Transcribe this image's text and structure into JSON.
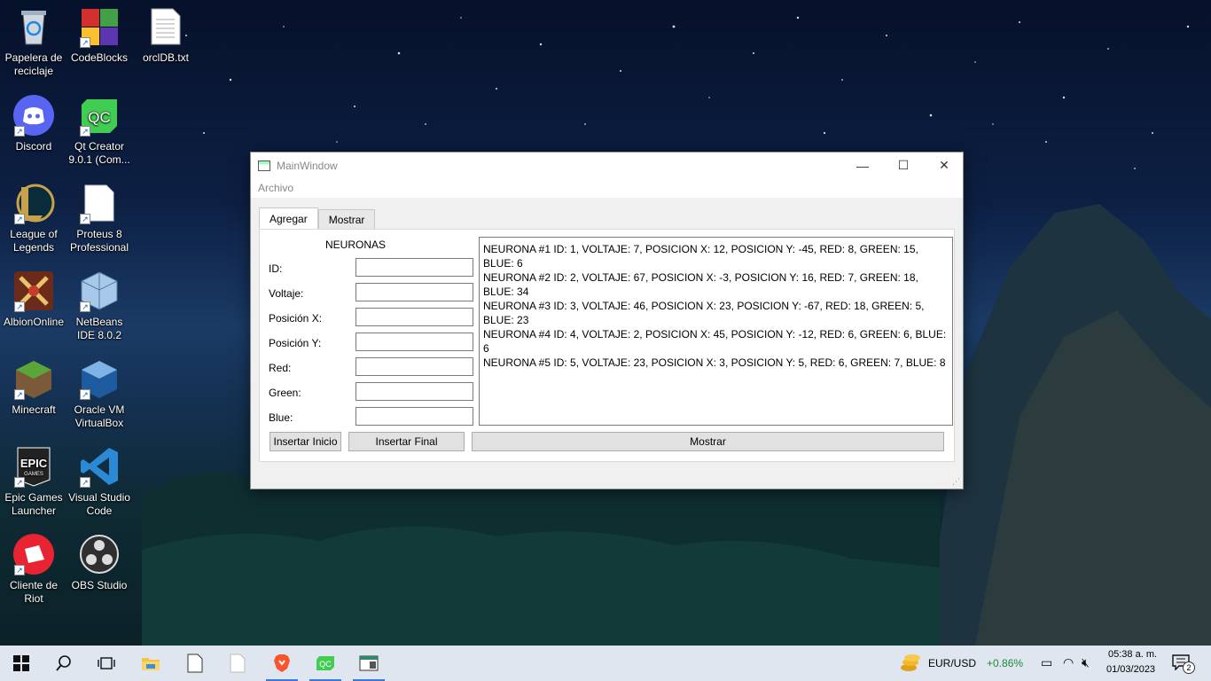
{
  "desktop": {
    "icons": [
      {
        "label": "Papelera de reciclaje",
        "icon": "recycle-bin-icon"
      },
      {
        "label": "CodeBlocks",
        "icon": "codeblocks-icon"
      },
      {
        "label": "orclDB.txt",
        "icon": "text-file-icon"
      },
      {
        "label": "Discord",
        "icon": "discord-icon"
      },
      {
        "label": "Qt Creator 9.0.1 (Com...",
        "icon": "qt-creator-icon"
      },
      {
        "label": "League of Legends",
        "icon": "league-of-legends-icon"
      },
      {
        "label": "Proteus 8 Professional",
        "icon": "proteus-icon"
      },
      {
        "label": "AlbionOnline",
        "icon": "albion-online-icon"
      },
      {
        "label": "NetBeans IDE 8.0.2",
        "icon": "netbeans-icon"
      },
      {
        "label": "Minecraft",
        "icon": "minecraft-icon"
      },
      {
        "label": "Oracle VM VirtualBox",
        "icon": "virtualbox-icon"
      },
      {
        "label": "Epic Games Launcher",
        "icon": "epic-games-icon"
      },
      {
        "label": "Visual Studio Code",
        "icon": "vscode-icon"
      },
      {
        "label": "Cliente de Riot",
        "icon": "riot-client-icon"
      },
      {
        "label": "OBS Studio",
        "icon": "obs-studio-icon"
      }
    ]
  },
  "window": {
    "title": "MainWindow",
    "menu": [
      "Archivo"
    ],
    "tabs": [
      "Agregar",
      "Mostrar"
    ],
    "form": {
      "heading": "NEURONAS",
      "fields": [
        {
          "label": "ID:",
          "value": ""
        },
        {
          "label": "Voltaje:",
          "value": ""
        },
        {
          "label": "Posición X:",
          "value": ""
        },
        {
          "label": "Posición Y:",
          "value": ""
        },
        {
          "label": "Red:",
          "value": ""
        },
        {
          "label": "Green:",
          "value": ""
        },
        {
          "label": "Blue:",
          "value": ""
        }
      ],
      "insert_start_label": "Insertar Inicio",
      "insert_end_label": "Insertar Final"
    },
    "output_lines": [
      "NEURONA #1 ID: 1, VOLTAJE: 7, POSICION X: 12, POSICION Y: -45, RED: 8, GREEN: 15, BLUE: 6",
      "NEURONA #2 ID: 2, VOLTAJE: 67, POSICION X: -3, POSICION Y: 16, RED: 7, GREEN: 18, BLUE: 34",
      "NEURONA #3 ID: 3, VOLTAJE: 46, POSICION X: 23, POSICION Y: -67, RED: 18, GREEN: 5, BLUE: 23",
      "NEURONA #4 ID: 4, VOLTAJE: 2, POSICION X: 45, POSICION Y: -12, RED: 6, GREEN: 6, BLUE: 6",
      "NEURONA #5 ID: 5, VOLTAJE: 23, POSICION X: 3, POSICION Y: 5, RED: 6, GREEN: 7, BLUE: 8"
    ],
    "show_label": "Mostrar"
  },
  "taskbar": {
    "ticker": "EUR/USD",
    "ticker_change": "+0.86%",
    "ticker_color": "#1a8a3a",
    "time": "05:38 a. m.",
    "date": "01/03/2023",
    "notification_count": "2"
  }
}
